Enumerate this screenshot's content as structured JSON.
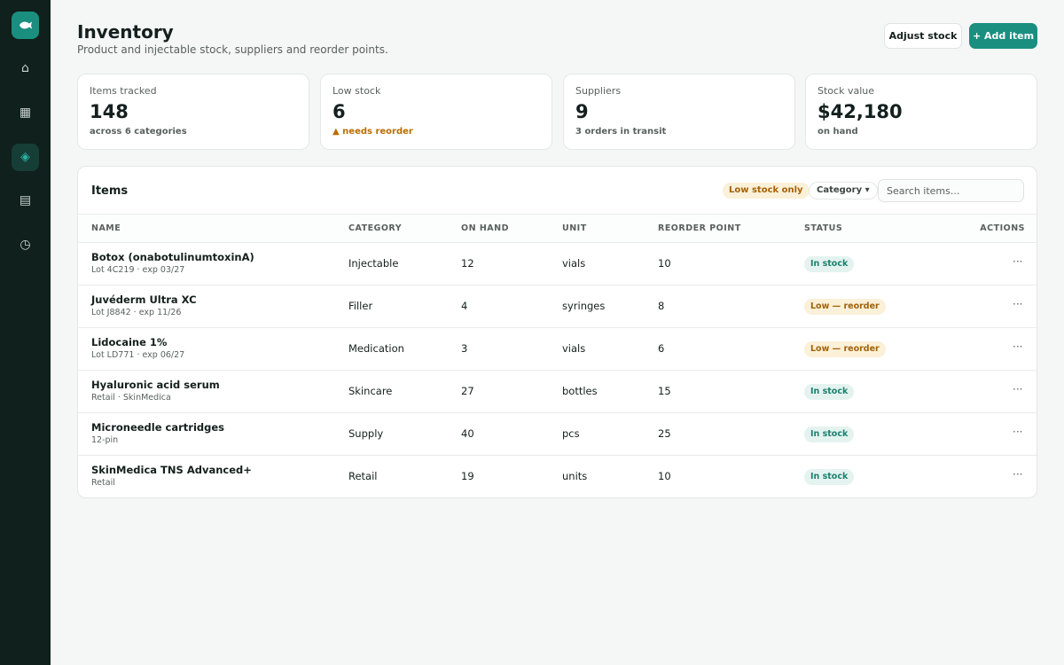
{
  "nav": [
    {
      "icon": "home-icon",
      "glyph": "⌂",
      "active": false
    },
    {
      "icon": "calendar-icon",
      "glyph": "▦",
      "active": false
    },
    {
      "icon": "inventory-icon",
      "glyph": "◈",
      "active": true
    },
    {
      "icon": "records-icon",
      "glyph": "▤",
      "active": false
    },
    {
      "icon": "history-icon",
      "glyph": "◷",
      "active": false
    }
  ],
  "header": {
    "title": "Inventory",
    "subtitle": "Product and injectable stock, suppliers and reorder points.",
    "adjust_label": "Adjust stock",
    "add_label": "+ Add item"
  },
  "stats": [
    {
      "label": "Items tracked",
      "value": "148",
      "note": "across 6 categories",
      "warn": false
    },
    {
      "label": "Low stock",
      "value": "6",
      "note": "▲ needs reorder",
      "warn": true
    },
    {
      "label": "Suppliers",
      "value": "9",
      "note": "3 orders in transit",
      "warn": false
    },
    {
      "label": "Stock value",
      "value": "$42,180",
      "note": "on hand",
      "warn": false
    }
  ],
  "items": {
    "title": "Items",
    "filter_low": "Low stock only",
    "filter_category": "Category ▾",
    "search_placeholder": "Search items...",
    "columns": [
      "NAME",
      "CATEGORY",
      "ON HAND",
      "UNIT",
      "REORDER POINT",
      "STATUS",
      "ACTIONS"
    ],
    "rows": [
      {
        "name": "Botox (onabotulinumtoxinA)",
        "sub": "Lot 4C219 · exp 03/27",
        "category": "Injectable",
        "on_hand": "12",
        "unit": "vials",
        "reorder": "10",
        "status": "In stock",
        "low": false,
        "action": "···"
      },
      {
        "name": "Juvéderm Ultra XC",
        "sub": "Lot J8842 · exp 11/26",
        "category": "Filler",
        "on_hand": "4",
        "unit": "syringes",
        "reorder": "8",
        "status": "Low — reorder",
        "low": true,
        "action": "···"
      },
      {
        "name": "Lidocaine 1%",
        "sub": "Lot LD771 · exp 06/27",
        "category": "Medication",
        "on_hand": "3",
        "unit": "vials",
        "reorder": "6",
        "status": "Low — reorder",
        "low": true,
        "action": "···"
      },
      {
        "name": "Hyaluronic acid serum",
        "sub": "Retail · SkinMedica",
        "category": "Skincare",
        "on_hand": "27",
        "unit": "bottles",
        "reorder": "15",
        "status": "In stock",
        "low": false,
        "action": "···"
      },
      {
        "name": "Microneedle cartridges",
        "sub": "12-pin",
        "category": "Supply",
        "on_hand": "40",
        "unit": "pcs",
        "reorder": "25",
        "status": "In stock",
        "low": false,
        "action": "···"
      },
      {
        "name": "SkinMedica TNS Advanced+",
        "sub": "Retail",
        "category": "Retail",
        "on_hand": "19",
        "unit": "units",
        "reorder": "10",
        "status": "In stock",
        "low": false,
        "action": "···"
      }
    ]
  }
}
